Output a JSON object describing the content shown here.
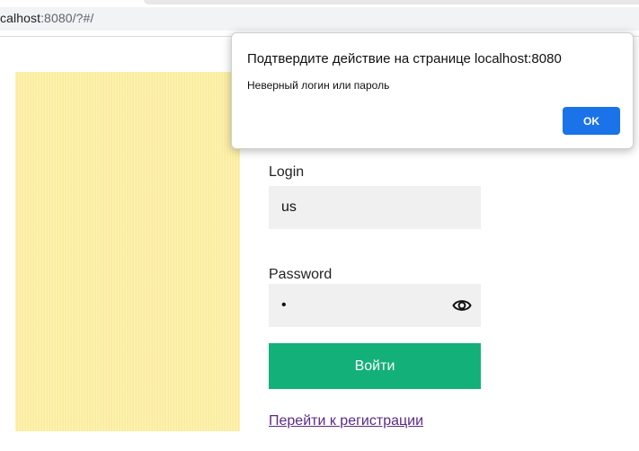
{
  "browser": {
    "url_host": "calhost",
    "url_rest": ":8080/?#/"
  },
  "form": {
    "login_label": "Login",
    "login_value": "us",
    "password_label": "Password",
    "password_value": "•",
    "submit_label": "Войти",
    "register_link": "Перейти к регистрации",
    "eye_icon": "eye-icon"
  },
  "dialog": {
    "title": "Подтвердите действие на странице localhost:8080",
    "message": "Неверный логин или пароль",
    "ok_label": "OK"
  },
  "colors": {
    "accent_green": "#14b07a",
    "dialog_button_blue": "#1a73e8",
    "paper_yellow": "#fcee9c",
    "link_purple": "#5b2a86"
  }
}
